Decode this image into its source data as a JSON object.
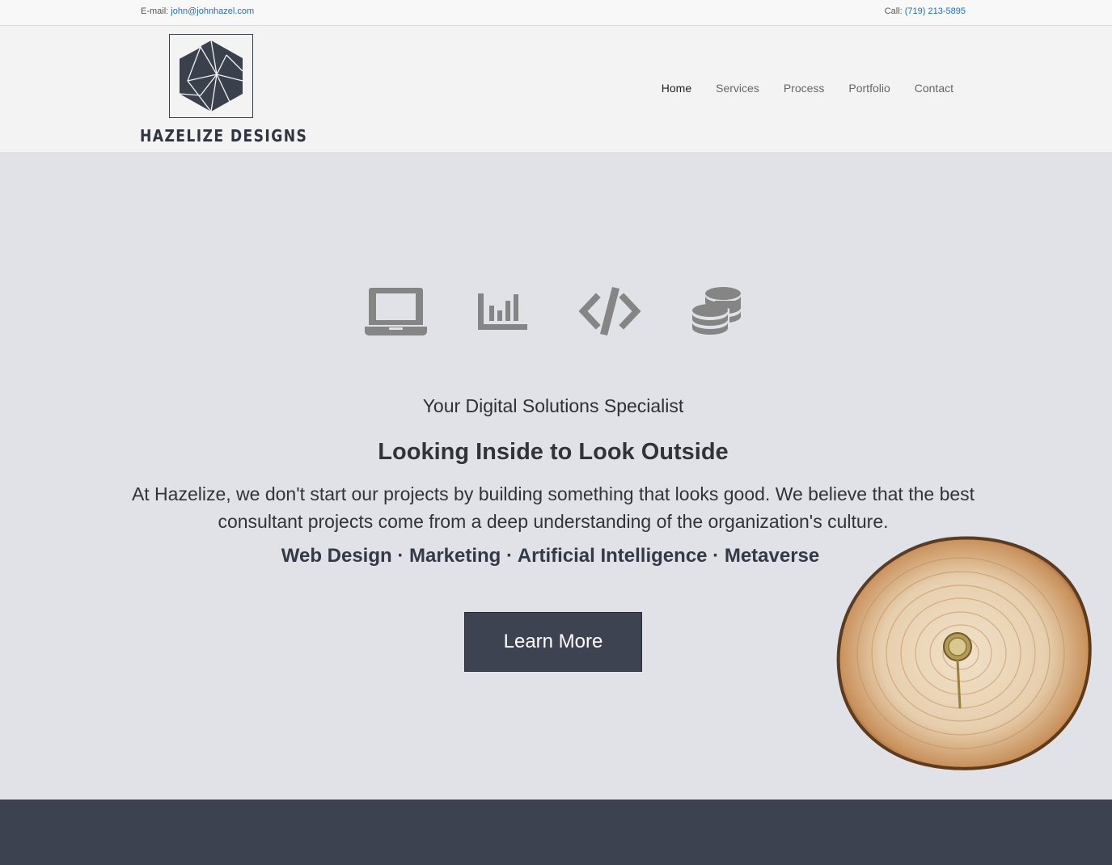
{
  "topbar": {
    "email_label": "E-mail:",
    "email": "john@johnhazel.com",
    "phone_label": "Call:",
    "phone": "(719) 213-5895"
  },
  "header": {
    "brand_name": "HAZELIZE DESIGNS",
    "nav": [
      "Home",
      "Services",
      "Process",
      "Portfolio",
      "Contact"
    ],
    "active_nav": "Home"
  },
  "hero": {
    "icons": [
      "laptop-icon",
      "bar-chart-icon",
      "code-icon",
      "coins-icon"
    ],
    "tagline": "Your Digital Solutions Specialist",
    "headline": "Looking Inside to Look Outside",
    "description": "At Hazelize, we don't start our projects by building something that looks good. We believe that the best consultant projects come from a deep understanding of the organization's culture.",
    "services_line": "Web Design · Marketing · Artificial Intelligence · Metaverse",
    "cta_label": "Learn More"
  },
  "colors": {
    "page_bg": "#e0e2e7",
    "header_bg": "#f3f3f3",
    "accent_dark": "#3e4352",
    "link_blue": "#1d6fb3",
    "icon_gray": "#858585"
  }
}
